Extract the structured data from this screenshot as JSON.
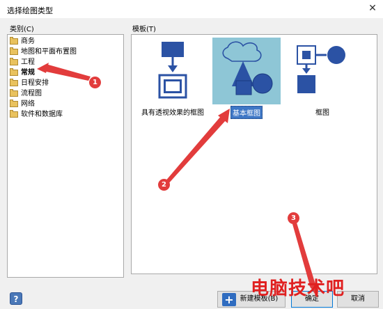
{
  "window": {
    "title": "选择绘图类型"
  },
  "categories": {
    "label": "类别(C)",
    "items": [
      "商务",
      "地图和平面布置图",
      "工程",
      "常规",
      "日程安排",
      "流程图",
      "网络",
      "软件和数据库"
    ],
    "selected_index": 3
  },
  "templates": {
    "label": "模板(T)",
    "items": [
      {
        "caption": "具有透视效果的框图"
      },
      {
        "caption": "基本框图"
      },
      {
        "caption": "框图"
      }
    ],
    "selected_index": 1
  },
  "buttons": {
    "help": "?",
    "new_from_template": "新建模板(B)",
    "ok": "确定",
    "cancel": "取消"
  },
  "annotations": [
    "1",
    "2",
    "3"
  ],
  "watermark": "电脑技术吧",
  "colors": {
    "arrow": "#e23c3c",
    "shape": "#2b52a4",
    "selection": "#3e77c6"
  }
}
